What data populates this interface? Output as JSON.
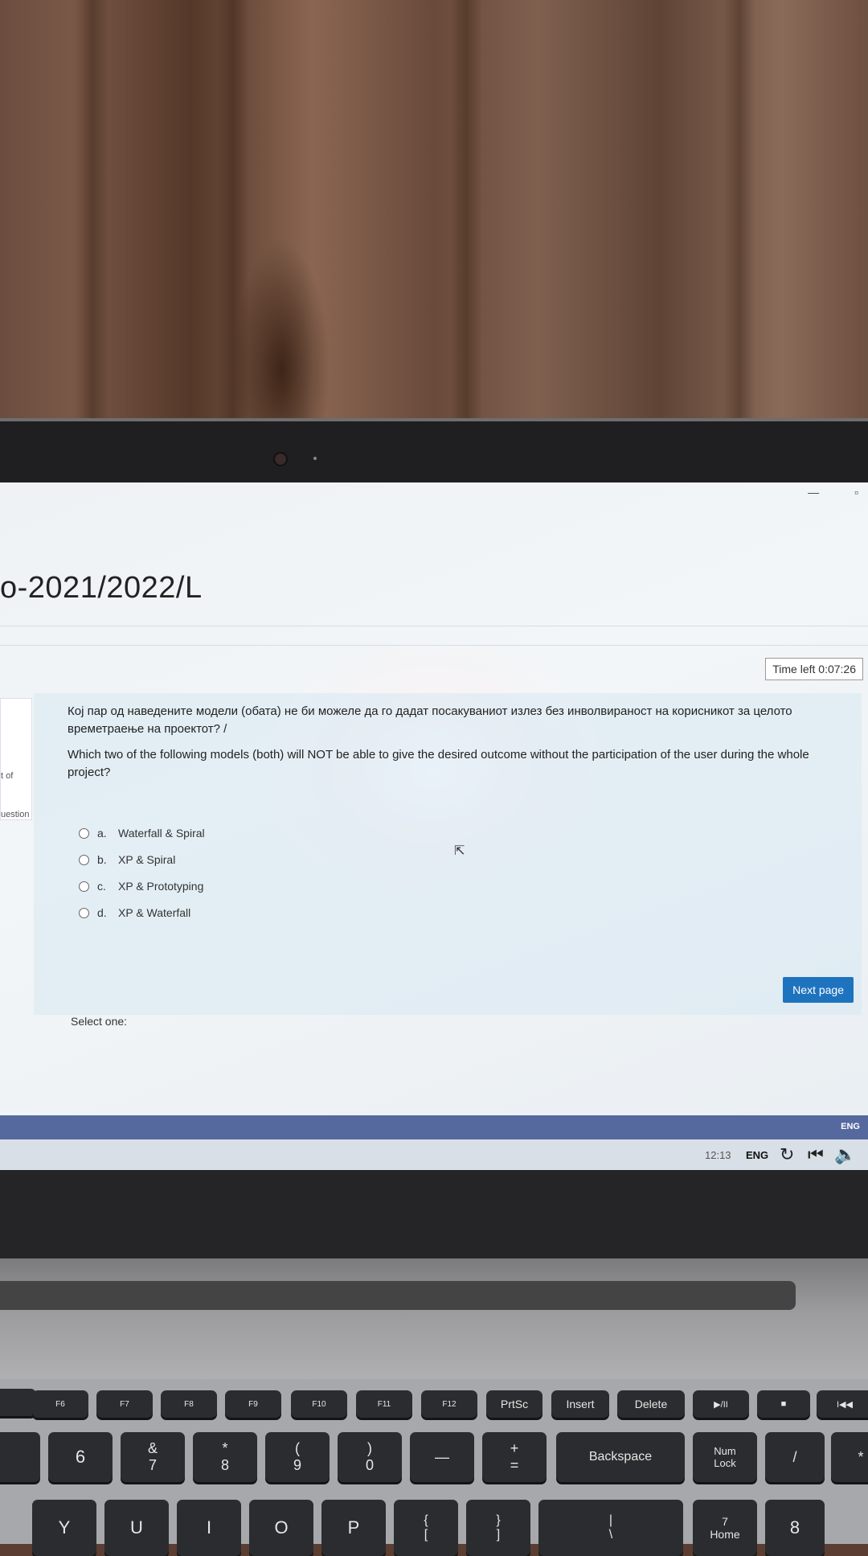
{
  "quiz": {
    "course_title": "o-2021/2022/L",
    "timer": "Time left 0:07:26",
    "nav_partial_1": "t of",
    "nav_partial_2": "uestion",
    "question_mk": "Кој пар од наведените модели (обата) не би можеле да го дадат посакуваниот излез без инволвираност на корисникот за целото времетраење на проектот? /",
    "question_en": "Which two of the following models (both) will NOT be able to give the desired outcome without the participation of the user during the whole project?",
    "select_label": "Select one:",
    "options": [
      {
        "letter": "a.",
        "text": "Waterfall & Spiral"
      },
      {
        "letter": "b.",
        "text": "XP & Spiral"
      },
      {
        "letter": "c.",
        "text": "XP & Prototyping"
      },
      {
        "letter": "d.",
        "text": "XP & Waterfall"
      }
    ],
    "next_button": "Next page"
  },
  "taskbar": {
    "lang_top": "ENG",
    "time": "12:13",
    "lang": "ENG"
  },
  "keyboard": {
    "fn_row": [
      "F6",
      "F7",
      "F8",
      "F9",
      "F10",
      "F11",
      "F12",
      "PrtSc",
      "Insert",
      "Delete",
      "▶/II",
      "■",
      "I◀◀"
    ],
    "number_row": [
      "6",
      "&\n7",
      "*\n8",
      "(\n9",
      ")\n0",
      "—",
      "+\n=",
      "Backspace",
      "Num\nLock",
      "/",
      "*"
    ],
    "letter_row": [
      "Y",
      "U",
      "I",
      "O",
      "P",
      "{\n[",
      "}\n]",
      "|\n\\",
      "7\nHome",
      "8"
    ]
  },
  "colors": {
    "accent": "#1e73be",
    "taskbar_blue": "#55699f"
  }
}
